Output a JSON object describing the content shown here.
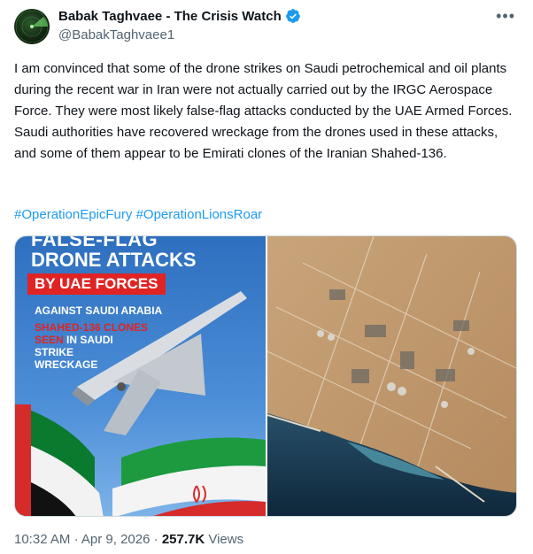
{
  "author": {
    "display_name": "Babak Taghvaee - The Crisis Watch",
    "handle": "@BabakTaghvaee1",
    "verified": true
  },
  "icons": {
    "avatar": "radar-avatar-icon",
    "verified": "verified-badge-icon",
    "more": "more-options-icon"
  },
  "colors": {
    "link": "#1d9bf0",
    "text": "#0f1419",
    "secondary": "#536471",
    "verified": "#1d9bf0",
    "banner_red": "#e02424"
  },
  "tweet": {
    "text": "I am convinced that some of the drone strikes on Saudi petrochemical and oil plants during the recent war in Iran were not actually carried out by the IRGC Aerospace Force. They were most likely false-flag attacks conducted by the UAE Armed Forces. Saudi authorities have recovered wreckage from the drones used in these attacks, and some of them appear to be Emirati clones of the Iranian Shahed-136.",
    "hashtags": [
      "#OperationEpicFury",
      "#OperationLionsRoar"
    ]
  },
  "media": {
    "left_image": {
      "top_text": "FALSE-FLAG",
      "headline": "DRONE ATTACKS",
      "banner": "BY UAE FORCES",
      "subheading": "AGAINST SAUDI ARABIA",
      "red_line1": "SHAHED-136 CLONES",
      "red_line2": "SEEN",
      "white_line2": "IN SAUDI",
      "white_line3": "STRIKE",
      "white_line4": "WRECKAGE"
    }
  },
  "footer": {
    "time": "10:32 AM",
    "separator": "·",
    "date": "Apr 9, 2026",
    "views_count": "257.7K",
    "views_label": "Views"
  }
}
